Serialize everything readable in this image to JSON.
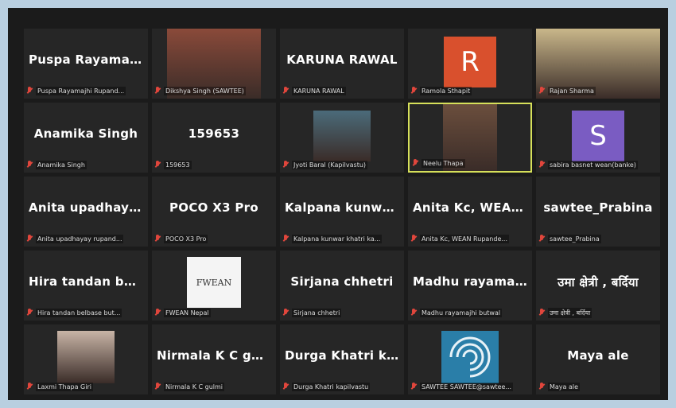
{
  "meeting": {
    "tiles": [
      {
        "big": "Puspa  Rayamaj...",
        "label": "Puspa Rayamajhi Rupand..."
      },
      {
        "big": "",
        "label": "Dikshya Singh (SAWTEE)"
      },
      {
        "big": "KARUNA RAWAL",
        "label": "KARUNA RAWAL"
      },
      {
        "big": "",
        "label": "Ramola Sthapit",
        "avatar": "R",
        "avatar_color": "#d9502d"
      },
      {
        "big": "",
        "label": "Rajan Sharma"
      },
      {
        "big": "Anamika Singh",
        "label": "Anamika Singh"
      },
      {
        "big": "159653",
        "label": "159653"
      },
      {
        "big": "",
        "label": "Jyoti Baral (Kapilvastu)"
      },
      {
        "big": "",
        "label": "Neelu Thapa",
        "active": true
      },
      {
        "big": "",
        "label": "sabira basnet wean(banke)",
        "avatar": "S",
        "avatar_color": "#7a5cc2"
      },
      {
        "big": "Anita  upadhaya...",
        "label": "Anita upadhayay rupand..."
      },
      {
        "big": "POCO X3 Pro",
        "label": "POCO X3 Pro"
      },
      {
        "big": "Kalpana  kunwa...",
        "label": "Kalpana kunwar khatri ka..."
      },
      {
        "big": "Anita Kc, WEAN...",
        "label": "Anita Kc, WEAN Rupande..."
      },
      {
        "big": "sawtee_Prabina",
        "label": "sawtee_Prabina"
      },
      {
        "big": "Hira tandan bel...",
        "label": "Hira tandan belbase but..."
      },
      {
        "big": "",
        "label": "FWEAN Nepal",
        "logo": "FWEAN"
      },
      {
        "big": "Sirjana chhetri",
        "label": "Sirjana chhetri"
      },
      {
        "big": "Madhu  rayamaj...",
        "label": "Madhu rayamajhi butwal"
      },
      {
        "big": "उमा क्षेत्रीे , बर्दिया",
        "label": "उमा क्षेत्री , बर्दिया"
      },
      {
        "big": "",
        "label": "Laxmi Thapa Giri"
      },
      {
        "big": "Nirmala K C gul...",
        "label": "Nirmala K C gulmi"
      },
      {
        "big": "Durga Khatri ka...",
        "label": "Durga Khatri kapilvastu"
      },
      {
        "big": "",
        "label": "SAWTEE SAWTEE@sawtee...",
        "spiral": true
      },
      {
        "big": "Maya ale",
        "label": "Maya ale"
      }
    ]
  },
  "colors": {
    "background": "#b9cfe0",
    "panel": "#1b1b1b",
    "tile": "#262626",
    "active_border": "#d6e05a",
    "mute": "#e0463c"
  }
}
